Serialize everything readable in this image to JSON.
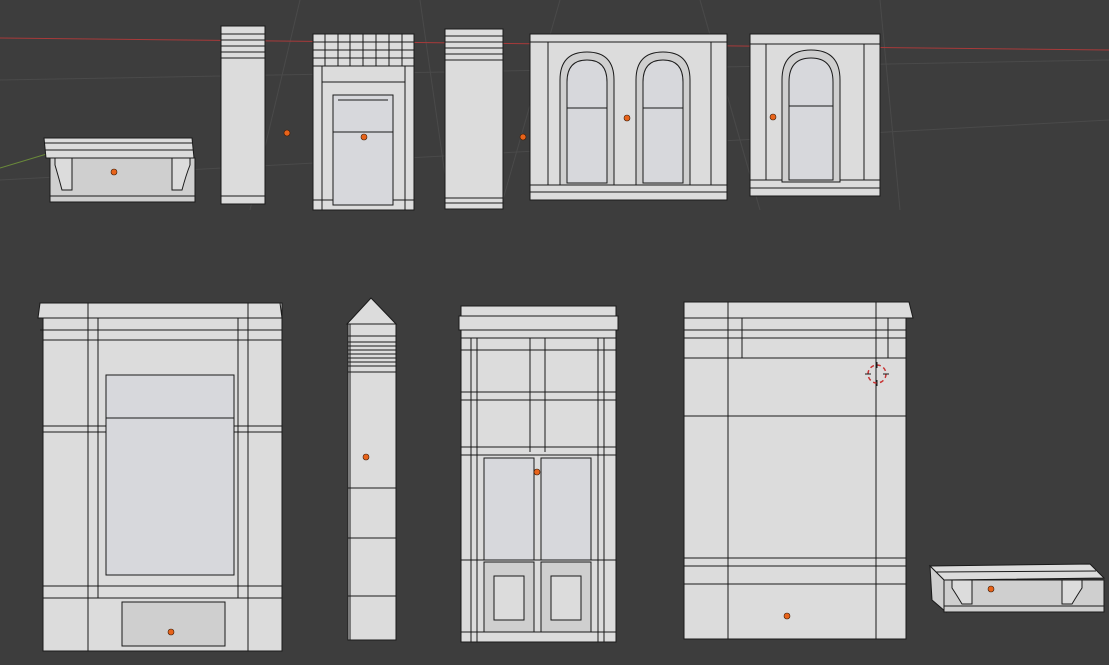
{
  "viewport": {
    "background": "#3d3d3d",
    "axis_x_color": "#a83a3a",
    "axis_y_color": "#6a8a3a",
    "origin_color": "#e8631a",
    "cursor_color": "#c83232"
  },
  "scene": {
    "objects": [
      {
        "id": "bracketed-ledge-top"
      },
      {
        "id": "narrow-pilaster-top"
      },
      {
        "id": "doorway-frame-top"
      },
      {
        "id": "wide-pilaster-top"
      },
      {
        "id": "double-arched-window-wall"
      },
      {
        "id": "single-arched-window-wall"
      },
      {
        "id": "large-storefront-panel"
      },
      {
        "id": "obelisk-column"
      },
      {
        "id": "double-door-frame"
      },
      {
        "id": "large-wall-panel"
      },
      {
        "id": "bracketed-ledge-bottom"
      }
    ]
  }
}
